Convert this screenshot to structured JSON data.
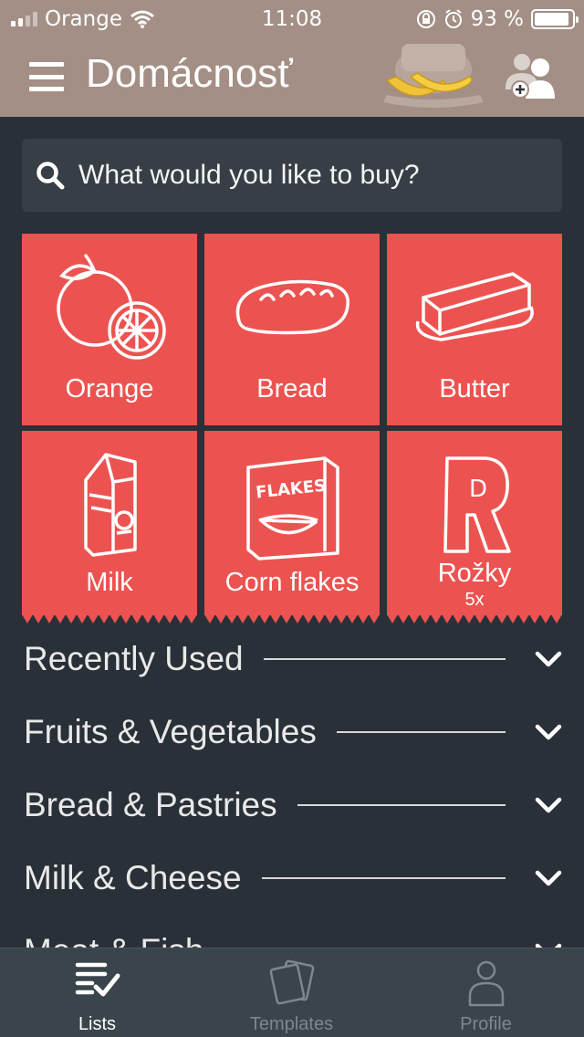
{
  "status_bar": {
    "carrier": "Orange",
    "time": "11:08",
    "battery_percent": "93 %",
    "battery_level": 0.93,
    "signal_bars": 2
  },
  "header": {
    "title": "Domácnosť"
  },
  "search": {
    "placeholder": "What would you like to buy?"
  },
  "tiles": [
    {
      "label": "Orange",
      "icon": "orange-icon"
    },
    {
      "label": "Bread",
      "icon": "bread-icon"
    },
    {
      "label": "Butter",
      "icon": "butter-icon"
    },
    {
      "label": "Milk",
      "icon": "milk-carton-icon"
    },
    {
      "label": "Corn flakes",
      "icon": "cornflakes-box-icon",
      "box_text": "FLAKES"
    },
    {
      "label": "Rožky",
      "quantity": "5x",
      "icon": "letter-r-icon",
      "letter": "R",
      "badge_letter": "D"
    }
  ],
  "categories": [
    {
      "label": "Recently Used"
    },
    {
      "label": "Fruits & Vegetables"
    },
    {
      "label": "Bread & Pastries"
    },
    {
      "label": "Milk & Cheese"
    },
    {
      "label": "Meat & Fish"
    }
  ],
  "tab_bar": {
    "tabs": [
      {
        "label": "Lists",
        "icon": "checklist-icon",
        "active": true
      },
      {
        "label": "Templates",
        "icon": "cards-icon",
        "active": false
      },
      {
        "label": "Profile",
        "icon": "person-icon",
        "active": false
      }
    ]
  },
  "colors": {
    "background": "#2a3038",
    "header": "#a38f85",
    "tile": "#ec5350",
    "search_bg": "#383e45",
    "tabbar": "#39444b",
    "inactive_tab": "#7d878d"
  }
}
